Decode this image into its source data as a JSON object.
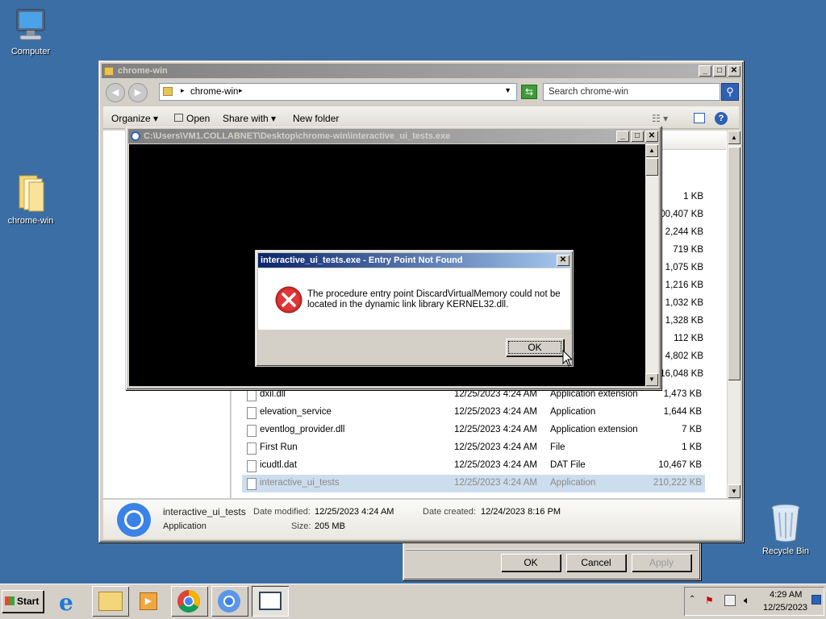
{
  "desktop": {
    "icons": [
      {
        "label": "Computer"
      },
      {
        "label": "chrome-win"
      },
      {
        "label": "Recycle Bin"
      }
    ]
  },
  "explorer": {
    "title": "chrome-win",
    "breadcrumb": "chrome-win",
    "search_placeholder": "Search chrome-win",
    "toolbar": {
      "organize": "Organize",
      "open": "Open",
      "share": "Share with",
      "new_folder": "New folder"
    },
    "sizes_upper": [
      "1 KB",
      "00,407 KB",
      "2,244 KB",
      "719 KB",
      "1,075 KB",
      "1,216 KB",
      "1,032 KB",
      "1,328 KB",
      "112 KB",
      "4,802 KB",
      "16,048 KB"
    ],
    "files": [
      {
        "name": "dxil.dll",
        "date": "12/25/2023 4:24 AM",
        "type": "Application extension",
        "size": "1,473 KB"
      },
      {
        "name": "elevation_service",
        "date": "12/25/2023 4:24 AM",
        "type": "Application",
        "size": "1,644 KB"
      },
      {
        "name": "eventlog_provider.dll",
        "date": "12/25/2023 4:24 AM",
        "type": "Application extension",
        "size": "7 KB"
      },
      {
        "name": "First Run",
        "date": "12/25/2023 4:24 AM",
        "type": "File",
        "size": "1 KB"
      },
      {
        "name": "icudtl.dat",
        "date": "12/25/2023 4:24 AM",
        "type": "DAT File",
        "size": "10,467 KB"
      },
      {
        "name": "interactive_ui_tests",
        "date": "12/25/2023 4:24 AM",
        "type": "Application",
        "size": "210,222 KB"
      }
    ],
    "details": {
      "name": "interactive_ui_tests",
      "type": "Application",
      "modified_label": "Date modified:",
      "modified": "12/25/2023 4:24 AM",
      "created_label": "Date created:",
      "created": "12/24/2023 8:16 PM",
      "size_label": "Size:",
      "size": "205 MB"
    }
  },
  "console": {
    "title": "C:\\Users\\VM1.COLLABNET\\Desktop\\chrome-win\\interactive_ui_tests.exe"
  },
  "error_dialog": {
    "title": "interactive_ui_tests.exe - Entry Point Not Found",
    "message_line1": "The procedure entry point DiscardVirtualMemory could not be",
    "message_line2": "located in the dynamic link library KERNEL32.dll.",
    "ok_label": "OK"
  },
  "properties_dialog": {
    "ok_label": "OK",
    "cancel_label": "Cancel",
    "apply_label": "Apply"
  },
  "taskbar": {
    "start_label": "Start",
    "time": "4:29 AM",
    "date": "12/25/2023"
  }
}
